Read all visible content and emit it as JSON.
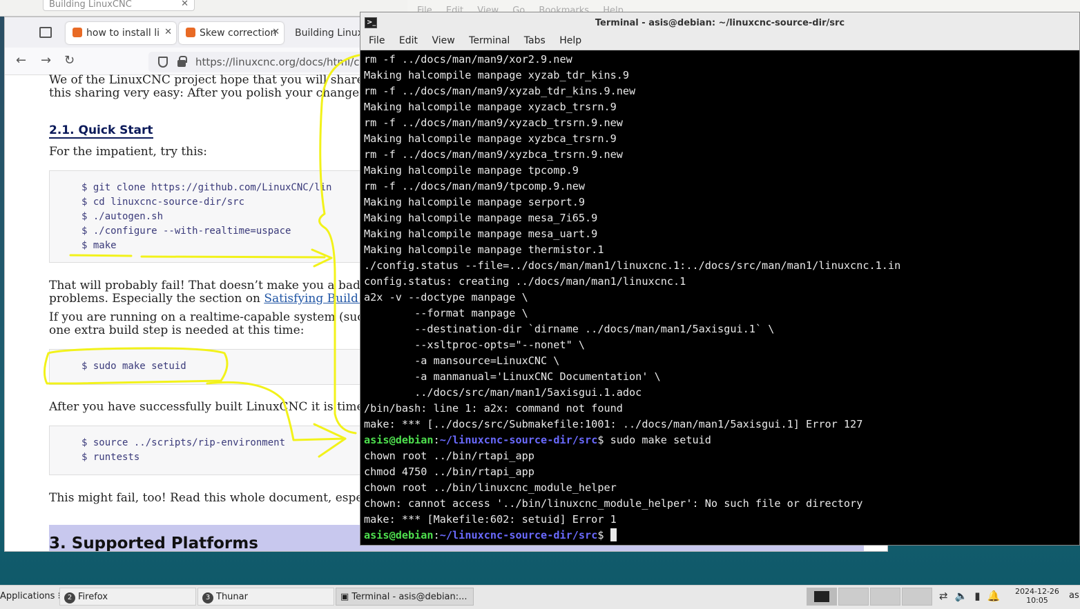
{
  "background_window": {
    "tab_label": "Building LinuxCNC",
    "menu": [
      "File",
      "Edit",
      "View",
      "Go",
      "Bookmarks",
      "Help"
    ]
  },
  "firefox": {
    "tabs": [
      {
        "label": "how to install li"
      },
      {
        "label": "Skew correction"
      },
      {
        "label": "Building Linux"
      }
    ],
    "url": "https://linuxcnc.org/docs/html/code",
    "content": {
      "intro_line1": "We of the LinuxCNC project hope that you will share yo",
      "intro_line2": "this sharing very easy: After you polish your changes ar",
      "quick_start_heading": "2.1. Quick Start",
      "impatient": "For the impatient, try this:",
      "code1": [
        "$ git clone https://github.com/LinuxCNC/lin",
        "$ cd linuxcnc-source-dir/src",
        "$ ./autogen.sh",
        "$ ./configure --with-realtime=uspace",
        "$ make"
      ],
      "fail_line1": "That will probably fail! That doesn’t make you a bad per",
      "fail_line2_prefix": "problems. Especially the section on ",
      "fail_line2_link": "Satisfying Build De",
      "rt_line1": "If you are running on a realtime-capable system (such a",
      "rt_line2": "one extra build step is needed at this time:",
      "code2": [
        "$ sudo make setuid"
      ],
      "after_built": "After you have successfully built LinuxCNC it is time to",
      "code3": [
        "$ source ../scripts/rip-environment",
        "$ runtests"
      ],
      "might_fail": "This might fail, too! Read this whole document, especia",
      "section3_heading": "3. Supported Platforms"
    }
  },
  "terminal": {
    "title": "Terminal - asis@debian: ~/linuxcnc-source-dir/src",
    "menu": [
      "File",
      "Edit",
      "View",
      "Terminal",
      "Tabs",
      "Help"
    ],
    "prompt_user": "asis@debian",
    "prompt_path": "~/linuxcnc-source-dir/src",
    "lines_before": [
      "rm -f ../docs/man/man9/xor2.9.new",
      "Making halcompile manpage xyzab_tdr_kins.9",
      "rm -f ../docs/man/man9/xyzab_tdr_kins.9.new",
      "Making halcompile manpage xyzacb_trsrn.9",
      "rm -f ../docs/man/man9/xyzacb_trsrn.9.new",
      "Making halcompile manpage xyzbca_trsrn.9",
      "rm -f ../docs/man/man9/xyzbca_trsrn.9.new",
      "Making halcompile manpage tpcomp.9",
      "rm -f ../docs/man/man9/tpcomp.9.new",
      "Making halcompile manpage serport.9",
      "Making halcompile manpage mesa_7i65.9",
      "Making halcompile manpage mesa_uart.9",
      "Making halcompile manpage thermistor.1",
      "./config.status --file=../docs/man/man1/linuxcnc.1:../docs/src/man/man1/linuxcnc.1.in",
      "config.status: creating ../docs/man/man1/linuxcnc.1",
      "a2x -v --doctype manpage \\",
      "        --format manpage \\",
      "        --destination-dir `dirname ../docs/man/man1/5axisgui.1` \\",
      "        --xsltproc-opts=\"--nonet\" \\",
      "        -a mansource=LinuxCNC \\",
      "        -a manmanual='LinuxCNC Documentation' \\",
      "        ../docs/src/man/man1/5axisgui.1.adoc",
      "/bin/bash: line 1: a2x: command not found",
      "make: *** [../docs/src/Submakefile:1001: ../docs/man/man1/5axisgui.1] Error 127"
    ],
    "command": " sudo make setuid",
    "lines_after": [
      "chown root ../bin/rtapi_app",
      "chmod 4750 ../bin/rtapi_app",
      "chown root ../bin/linuxcnc_module_helper",
      "chown: cannot access '../bin/linuxcnc_module_helper': No such file or directory",
      "make: *** [Makefile:602: setuid] Error 1"
    ]
  },
  "taskbar": {
    "applications": "Applications",
    "firefox": {
      "badge": "2",
      "label": "Firefox"
    },
    "thunar": {
      "badge": "3",
      "label": "Thunar"
    },
    "terminal": {
      "label": "Terminal - asis@debian:..."
    },
    "date": "2024-12-26",
    "time": "10:05",
    "user": "as"
  },
  "colors": {
    "annotation": "#f2f21a",
    "prompt_user": "#4ee04e",
    "prompt_path": "#6a6aff",
    "link": "#2156a5"
  }
}
